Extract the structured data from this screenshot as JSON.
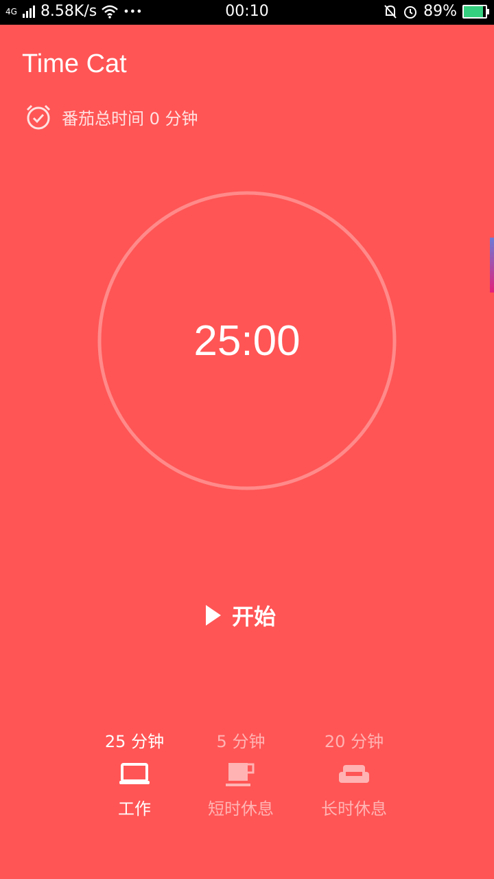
{
  "status_bar": {
    "network": "4G",
    "speed": "8.58K/s",
    "more": "•••",
    "time": "00:10",
    "battery": "89%",
    "battery_level": 0.89
  },
  "app": {
    "title": "Time Cat"
  },
  "summary": {
    "text": "番茄总时间 0 分钟"
  },
  "timer": {
    "display": "25:00"
  },
  "start_button": {
    "label": "开始"
  },
  "modes": [
    {
      "duration": "25 分钟",
      "label": "工作",
      "icon": "laptop-icon",
      "active": true
    },
    {
      "duration": "5 分钟",
      "label": "短时休息",
      "icon": "coffee-cup-icon",
      "active": false
    },
    {
      "duration": "20 分钟",
      "label": "长时休息",
      "icon": "sofa-icon",
      "active": false
    }
  ],
  "colors": {
    "background": "#ff5555",
    "ring": "#ff8a8a",
    "inactive_text": "#ffb3b3",
    "battery_fill": "#35d07f"
  }
}
